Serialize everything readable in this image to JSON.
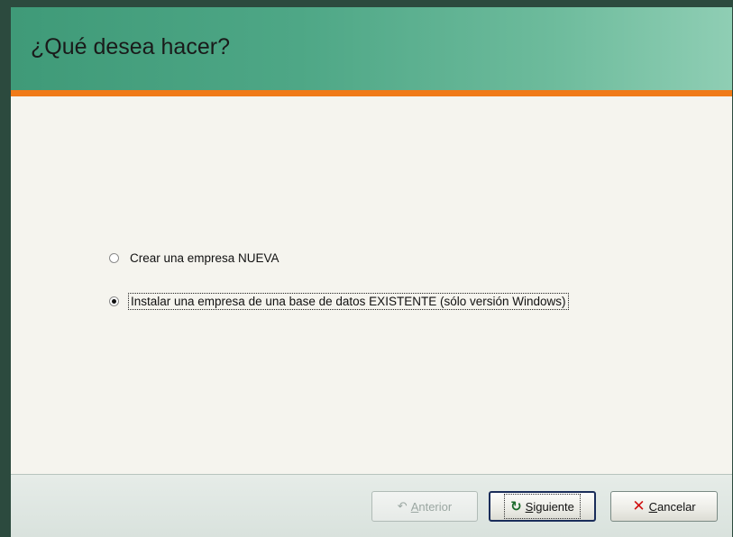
{
  "header": {
    "title": "¿Qué desea hacer?"
  },
  "options": [
    {
      "label": "Crear una empresa NUEVA",
      "selected": false
    },
    {
      "label": "Instalar una empresa de una base de datos EXISTENTE (sólo versión Windows)",
      "selected": true
    }
  ],
  "buttons": {
    "anterior": {
      "label": "Anterior",
      "icon": "undo-arrow-icon",
      "enabled": false
    },
    "siguiente": {
      "label": "Siguiente",
      "icon": "refresh-arrow-icon",
      "enabled": true
    },
    "cancelar": {
      "label": "Cancelar",
      "icon": "x-icon",
      "enabled": true
    }
  },
  "colors": {
    "header_start": "#3f9a78",
    "header_end": "#8fceb4",
    "accent_bar": "#f07a18",
    "window_border": "#2c4a3e"
  }
}
